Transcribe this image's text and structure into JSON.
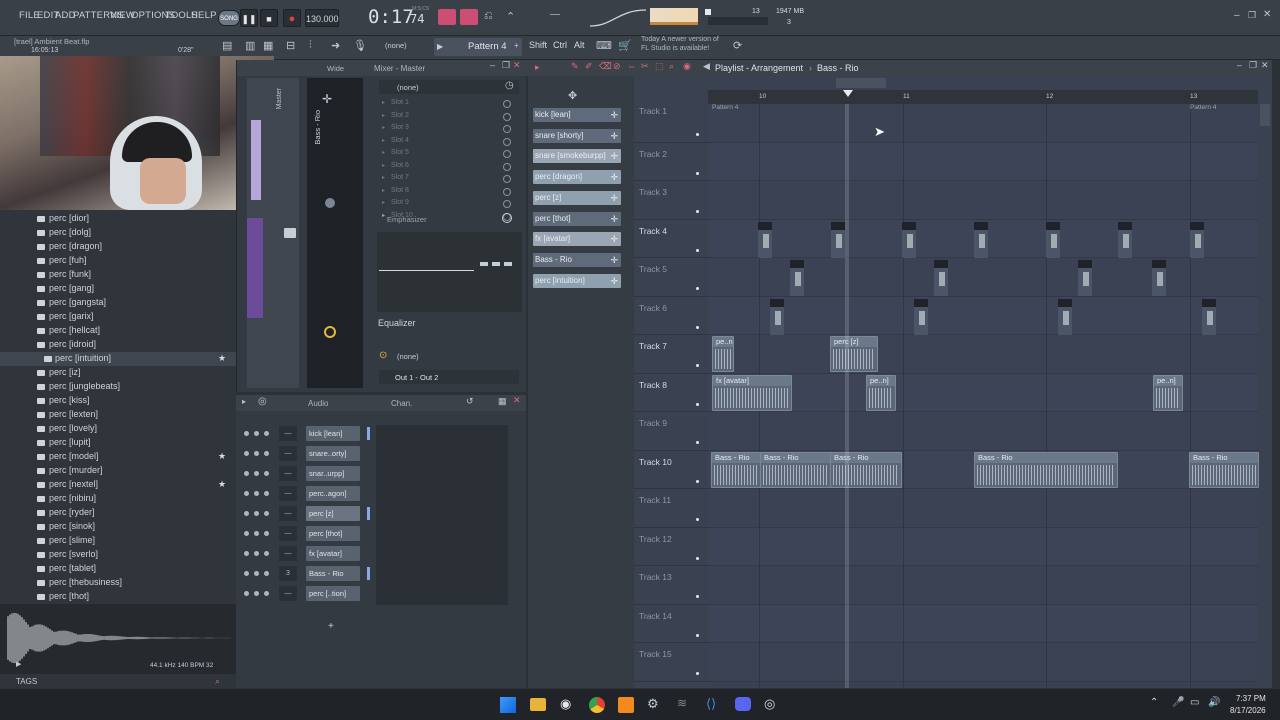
{
  "menu": [
    "FILE",
    "EDIT",
    "ADD",
    "PATTERNS",
    "VIEW",
    "OPTIONS",
    "TOOLS",
    "HELP"
  ],
  "transport": {
    "song_mode": "SONG",
    "tempo": "130.000",
    "time": "0:17",
    "time_small": "74",
    "time_label": "M:S:CS",
    "cpu": "13",
    "memory": "1947 MB",
    "voices": "3"
  },
  "project": {
    "title": "[trael] Ambient Beat.flp",
    "time": "16:05:13",
    "length": "0'28\""
  },
  "toolbar": {
    "pattern": "Pattern 4",
    "snap": "(none)",
    "news_line1": "Today  A newer version of",
    "news_line2": "FL Studio is available!"
  },
  "browser": {
    "items": [
      "perc [dior]",
      "perc [dolg]",
      "perc [dragon]",
      "perc [fuh]",
      "perc [funk]",
      "perc [gang]",
      "perc [gangsta]",
      "perc [garix]",
      "perc [hellcat]",
      "perc [idroid]",
      "perc [intuition]",
      "perc [iz]",
      "perc [junglebeats]",
      "perc [kiss]",
      "perc [lexten]",
      "perc [lovely]",
      "perc [lupit]",
      "perc [model]",
      "perc [murder]",
      "perc [nextel]",
      "perc [nibiru]",
      "perc [ryder]",
      "perc [sinok]",
      "perc [slime]",
      "perc [sverlo]",
      "perc [tablet]",
      "perc [thebusiness]",
      "perc [thot]"
    ],
    "selected": "perc [intuition]",
    "sample_info": "44.1 kHz 140 BPM 32",
    "tags_label": "TAGS"
  },
  "mixer": {
    "title": "Mixer - Master",
    "wide_label": "Wide",
    "insert_label": "Bass - Rio",
    "master_label": "Master",
    "slots_header": "(none)",
    "slots": [
      "Slot 1",
      "Slot 2",
      "Slot 3",
      "Slot 4",
      "Slot 5",
      "Slot 6",
      "Slot 7",
      "Slot 8",
      "Slot 9",
      "Slot 10"
    ],
    "effect": "Emphasizer",
    "eq_label": "Equalizer",
    "send_none": "(none)",
    "output": "Out 1 - Out 2"
  },
  "channel_rack": {
    "title_audio": "Audio",
    "title_chan": "Chan.",
    "channels": [
      "kick [lean]",
      "snare..orty]",
      "snar..urpp]",
      "perc..agon]",
      "perc [z]",
      "perc [thot]",
      "fx [avatar]",
      "Bass - Rio",
      "perc [..tion]"
    ],
    "bass_number": "3"
  },
  "picker": {
    "patterns": [
      {
        "name": "kick [lean]",
        "color": "#5f6b7a"
      },
      {
        "name": "snare [shorty]",
        "color": "#5f6b7a"
      },
      {
        "name": "snare [smokeburpp]",
        "color": "#9aa6b3"
      },
      {
        "name": "perc [dragon]",
        "color": "#8fa0ae"
      },
      {
        "name": "perc [z]",
        "color": "#8fa0ae"
      },
      {
        "name": "perc [thot]",
        "color": "#5f6b7a"
      },
      {
        "name": "fx [avatar]",
        "color": "#9aa6b3"
      },
      {
        "name": "Bass - Rio",
        "color": "#5f6b7a"
      },
      {
        "name": "perc [intuition]",
        "color": "#8fa0ae"
      }
    ]
  },
  "playlist": {
    "title": "Playlist - Arrangement",
    "breadcrumb": "Bass - Rio",
    "bars": [
      "10",
      "11",
      "12",
      "13"
    ],
    "header_clip": "Pattern 4",
    "tracks": [
      "Track 1",
      "Track 2",
      "Track 3",
      "Track 4",
      "Track 5",
      "Track 6",
      "Track 7",
      "Track 8",
      "Track 9",
      "Track 10",
      "Track 11",
      "Track 12",
      "Track 13",
      "Track 14",
      "Track 15"
    ],
    "clips": {
      "perc_z": "perc [z]",
      "fx_avatar": "fx [avatar]",
      "perc_short": "pe..n]",
      "bass": "Bass - Rio"
    }
  },
  "taskbar": {
    "time": "7:37 PM",
    "date": "8/17/2026"
  }
}
